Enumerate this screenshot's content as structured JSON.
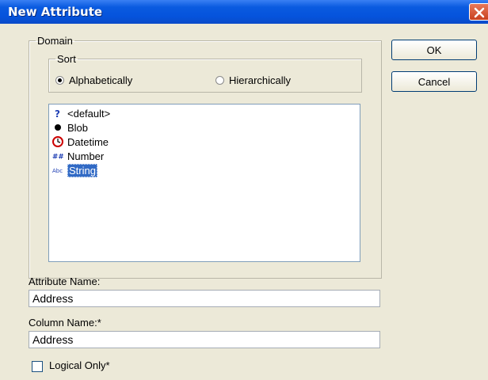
{
  "window": {
    "title": "New Attribute"
  },
  "domain": {
    "legend": "Domain",
    "sort": {
      "legend": "Sort",
      "options": [
        {
          "label": "Alphabetically",
          "checked": true
        },
        {
          "label": "Hierarchically",
          "checked": false
        }
      ]
    },
    "items": [
      {
        "label": "<default>",
        "icon": "question-icon",
        "selected": false
      },
      {
        "label": "Blob",
        "icon": "bullet-icon",
        "selected": false
      },
      {
        "label": "Datetime",
        "icon": "clock-icon",
        "selected": false
      },
      {
        "label": "Number",
        "icon": "hash-icon",
        "selected": false
      },
      {
        "label": "String",
        "icon": "abc-icon",
        "selected": true
      }
    ]
  },
  "buttons": {
    "ok": "OK",
    "cancel": "Cancel"
  },
  "attribute_name": {
    "label": "Attribute Name:",
    "value": "Address"
  },
  "column_name": {
    "label": "Column Name:*",
    "value": "Address"
  },
  "logical_only": {
    "label": "Logical Only*",
    "checked": false
  }
}
